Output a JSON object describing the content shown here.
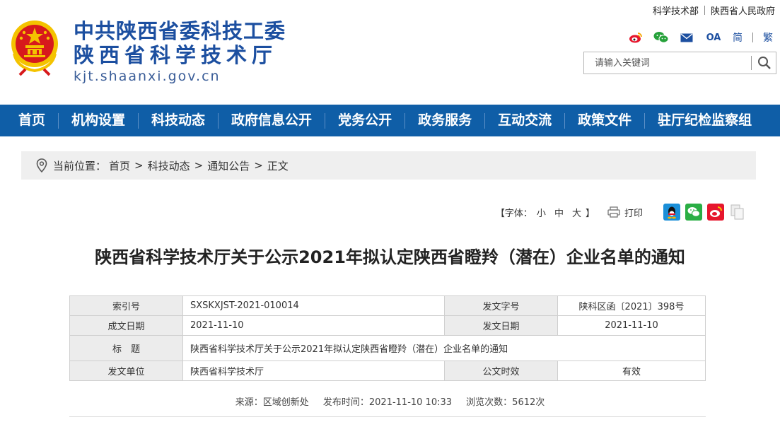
{
  "toplinks": {
    "link1": "科学技术部",
    "link2": "陕西省人民政府"
  },
  "header": {
    "name_line1": "中共陕西省委科技工委",
    "name_line2": "陕西省科学技术厅",
    "domain": "kjt.shaanxi.gov.cn"
  },
  "share": {
    "icons": [
      "weibo-icon",
      "wechat-icon",
      "email-icon",
      "oa-icon"
    ],
    "oa_text": "OA",
    "lang_simplified": "简",
    "lang_traditional": "繁"
  },
  "search": {
    "placeholder": "请输入关键词"
  },
  "nav": {
    "items": [
      "首页",
      "机构设置",
      "科技动态",
      "政府信息公开",
      "党务公开",
      "政务服务",
      "互动交流",
      "政策文件",
      "驻厅纪检监察组"
    ]
  },
  "breadcrumb": {
    "label": "当前位置：",
    "items": [
      "首页",
      "科技动态",
      "通知公告",
      "正文"
    ],
    "separator": ">"
  },
  "tools": {
    "font_prefix": "【字体：",
    "font_small": "小",
    "font_medium": "中",
    "font_large": "大",
    "font_suffix": "】",
    "print": "打印"
  },
  "document": {
    "title": "陕西省科学技术厅关于公示2021年拟认定陕西省瞪羚（潜在）企业名单的通知",
    "meta": {
      "index_label": "索引号",
      "index_value": "SXSKXJST-2021-010014",
      "docno_label": "发文字号",
      "docno_value": "陕科区函〔2021〕398号",
      "made_label": "成文日期",
      "made_value": "2021-11-10",
      "issued_label": "发文日期",
      "issued_value": "2021-11-10",
      "title_label": "标　题",
      "title_value": "陕西省科学技术厅关于公示2021年拟认定陕西省瞪羚（潜在）企业名单的通知",
      "unit_label": "发文单位",
      "unit_value": "陕西省科学技术厅",
      "validity_label": "公文时效",
      "validity_value": "有效"
    },
    "source": {
      "source_text": "来源：区域创新处",
      "time_text": "发布时间：2021-11-10 10:33",
      "views_text": "浏览次数：5612次"
    }
  },
  "colors": {
    "nav_bg": "#0f5ea7",
    "brand_blue": "#1c4fa0",
    "emblem_red": "#d7191c",
    "emblem_gold": "#f4c300"
  }
}
